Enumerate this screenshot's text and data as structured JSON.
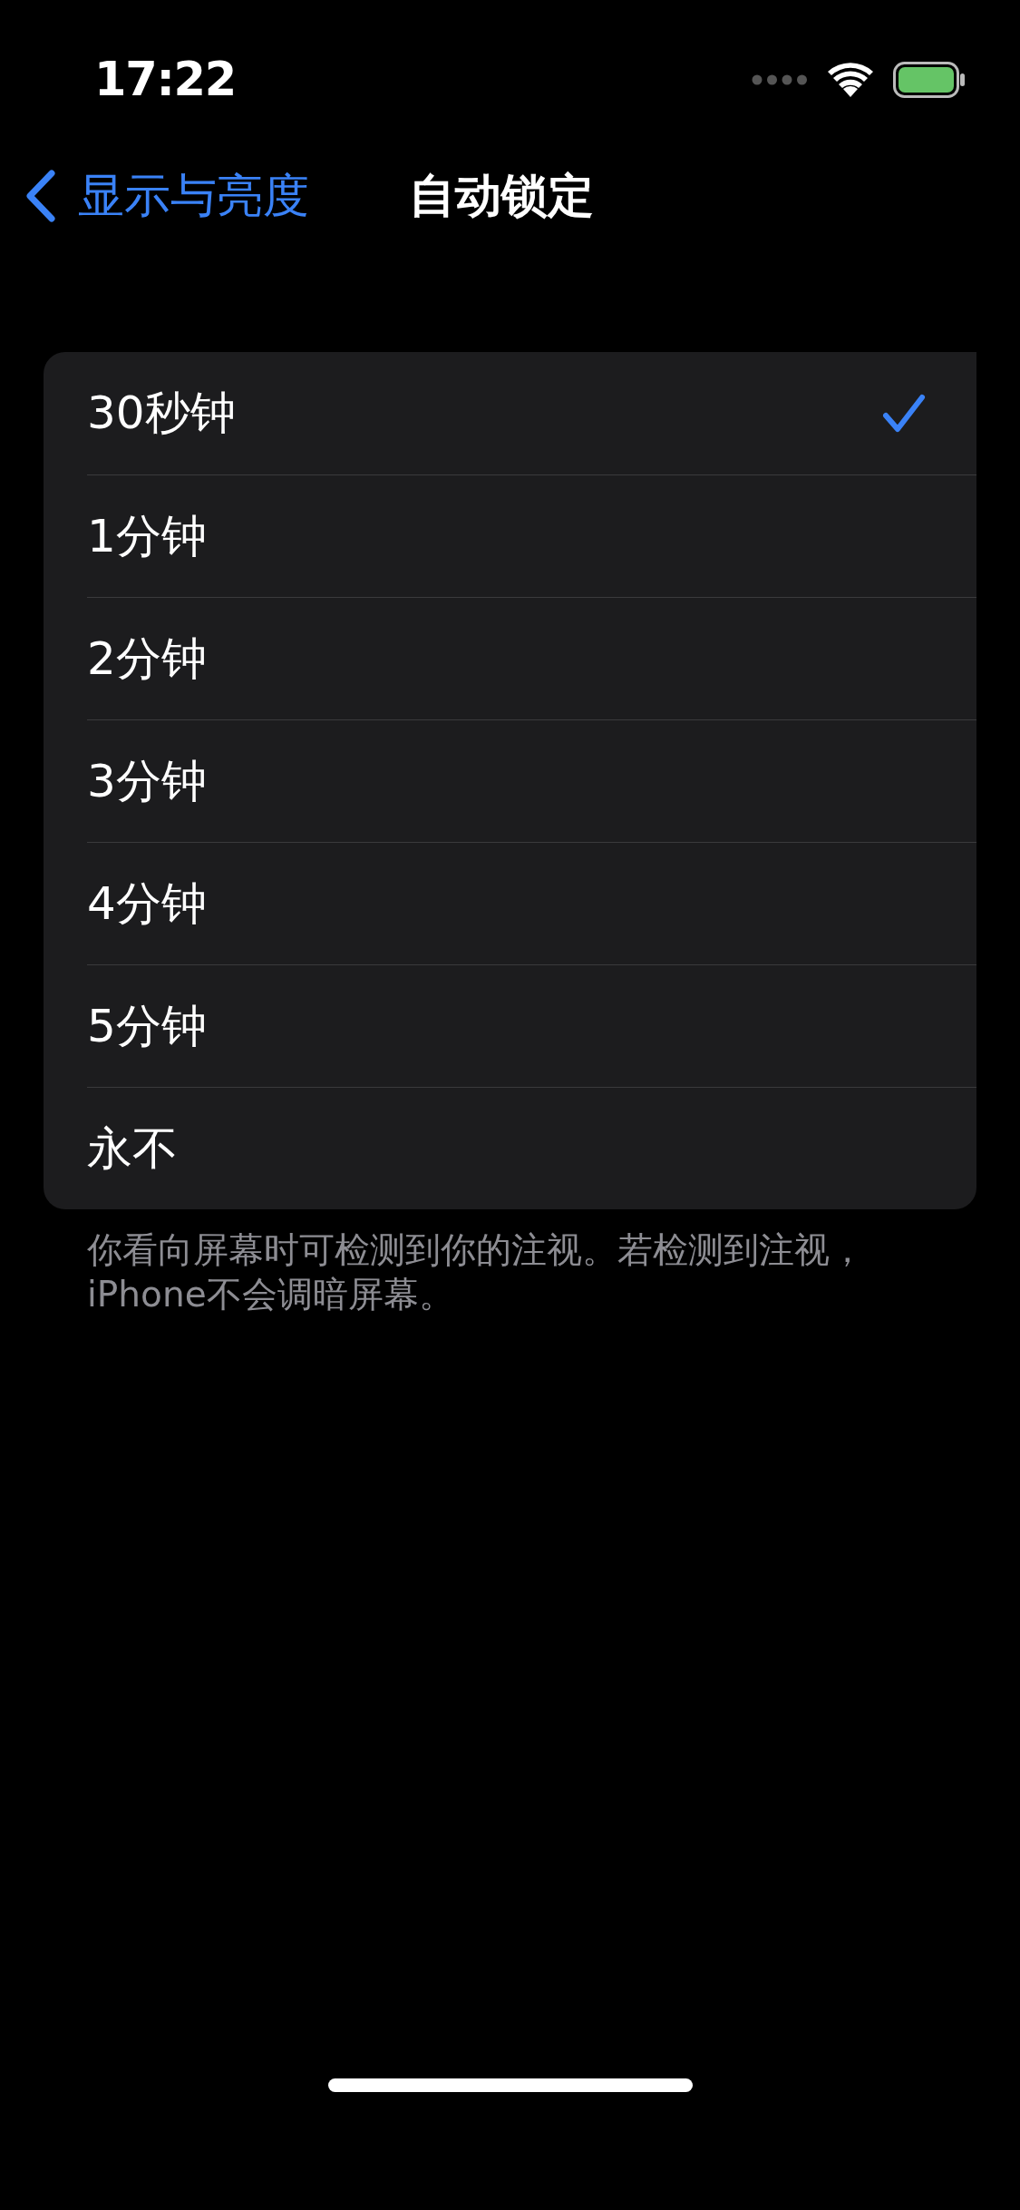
{
  "status_bar": {
    "time": "17:22"
  },
  "nav": {
    "back": "显示与亮度",
    "title": "自动锁定"
  },
  "options": [
    {
      "label": "30秒钟",
      "selected": true
    },
    {
      "label": "1分钟",
      "selected": false
    },
    {
      "label": "2分钟",
      "selected": false
    },
    {
      "label": "3分钟",
      "selected": false
    },
    {
      "label": "4分钟",
      "selected": false
    },
    {
      "label": "5分钟",
      "selected": false
    },
    {
      "label": "永不",
      "selected": false
    }
  ],
  "footer": "你看向屏幕时可检测到你的注视。若检测到注视，iPhone不会调暗屏幕。"
}
